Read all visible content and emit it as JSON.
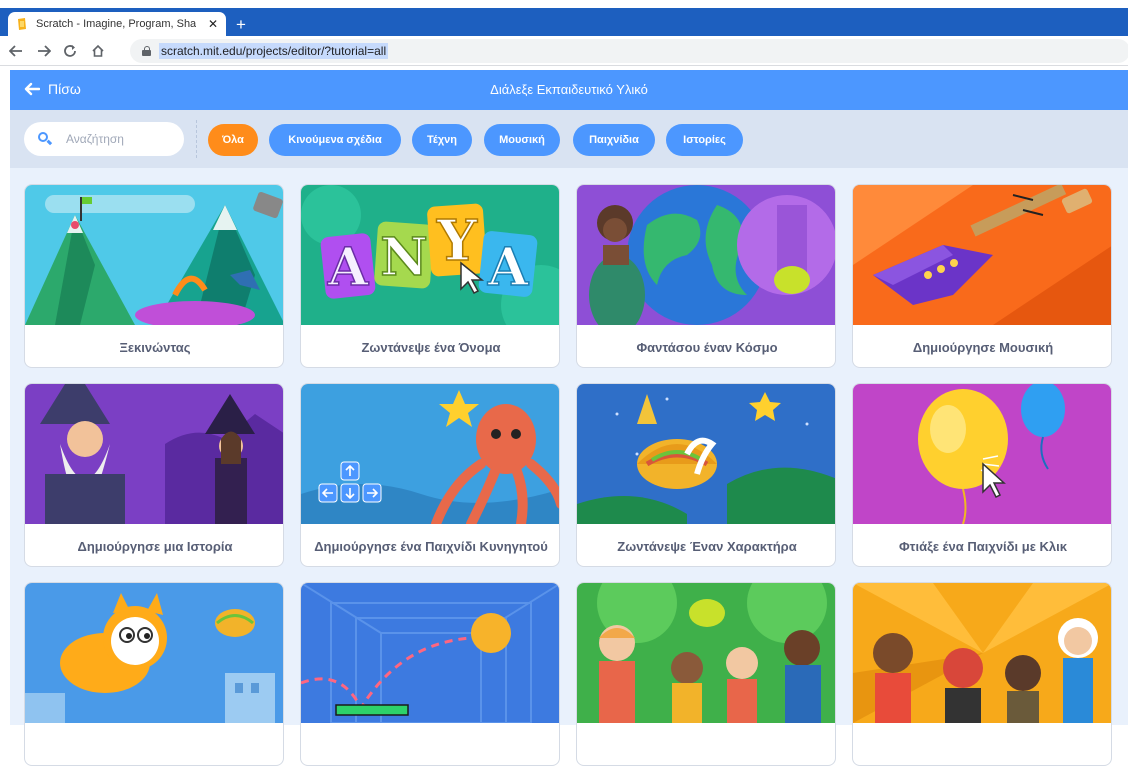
{
  "browser": {
    "tab_title": "Scratch - Imagine, Program, Shar",
    "tab_close": "✕",
    "new_tab": "+",
    "url": "scratch.mit.edu/projects/editor/?tutorial=all"
  },
  "header": {
    "back_label": "Πίσω",
    "title": "Διάλεξε Εκπαιδευτικό Υλικό"
  },
  "search": {
    "placeholder": "Αναζήτηση"
  },
  "filters": [
    {
      "label": "Όλα",
      "active": true
    },
    {
      "label": "Κινούμενα σχέδια",
      "active": false
    },
    {
      "label": "Τέχνη",
      "active": false
    },
    {
      "label": "Μουσική",
      "active": false
    },
    {
      "label": "Παιχνίδια",
      "active": false
    },
    {
      "label": "Ιστορίες",
      "active": false
    }
  ],
  "tutorials": [
    {
      "label": "Ξεκινώντας",
      "thumb": "getting-started"
    },
    {
      "label": "Ζωντάνεψε ένα Όνομα",
      "thumb": "animate-name"
    },
    {
      "label": "Φαντάσου έναν Κόσμο",
      "thumb": "imagine-world"
    },
    {
      "label": "Δημιούργησε Μουσική",
      "thumb": "make-music"
    },
    {
      "label": "Δημιούργησε μια Ιστορία",
      "thumb": "create-story"
    },
    {
      "label": "Δημιούργησε ένα Παιχνίδι Κυνηγητού",
      "thumb": "chase-game"
    },
    {
      "label": "Ζωντάνεψε Έναν Χαρακτήρα",
      "thumb": "animate-character"
    },
    {
      "label": "Φτιάξε ένα Παιχνίδι με Κλικ",
      "thumb": "clicker-game"
    },
    {
      "label": "",
      "thumb": "cat-flying"
    },
    {
      "label": "",
      "thumb": "pong-game"
    },
    {
      "label": "",
      "thumb": "cartoon-network-1"
    },
    {
      "label": "",
      "thumb": "cartoon-network-2"
    }
  ],
  "thumb_text": {
    "anya": [
      "A",
      "N",
      "Y",
      "A"
    ]
  },
  "colors": {
    "scratch_blue": "#4c97ff",
    "active_orange": "#ff8c1a",
    "browser_blue": "#1d5fbf"
  }
}
